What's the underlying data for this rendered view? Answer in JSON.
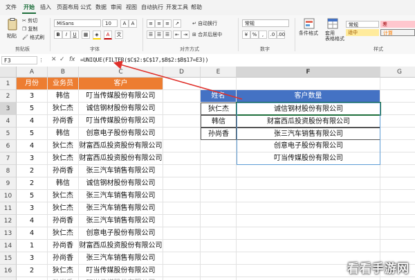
{
  "menu": [
    "文件",
    "开始",
    "插入",
    "页面布局",
    "公式",
    "数据",
    "审阅",
    "视图",
    "自动执行",
    "开发工具",
    "帮助"
  ],
  "menu_active_index": 1,
  "ribbon": {
    "paste": "粘贴",
    "cut": "剪切",
    "copy": "复制",
    "format_painter": "格式刷",
    "font_name": "MiSans",
    "font_size": "10",
    "wrap_text": "自动换行",
    "merge_center": "合并后居中",
    "number_format": "常规",
    "conditional_format": "条件格式",
    "format_as_table": "套用\n表格格式",
    "style_normal": "常规",
    "style_bad": "差",
    "style_neutral": "适中",
    "style_calc": "计算",
    "groups": {
      "clipboard": "剪贴板",
      "font": "字体",
      "alignment": "对齐方式",
      "number": "数字",
      "styles": "样式"
    },
    "colors": {
      "bad_bg": "#ffc7ce",
      "neutral_bg": "#ffeb9c",
      "calc_bg": "#f2f2f2"
    }
  },
  "formula_bar": {
    "namebox": "F3",
    "fx": "fx",
    "formula": "=UNIQUE(FILTER($C$2:$C$17,$B$2:$B$17=E3))"
  },
  "columns": [
    "A",
    "B",
    "C",
    "D",
    "E",
    "F",
    "G"
  ],
  "rows": [
    "1",
    "2",
    "3",
    "4",
    "5",
    "6",
    "7",
    "8",
    "9",
    "10",
    "11",
    "12",
    "13",
    "14",
    "15",
    "16",
    "17"
  ],
  "left_table": {
    "headers": [
      "月份",
      "业务员",
      "客户"
    ],
    "rows": [
      [
        "3",
        "韩信",
        "叮当传媒股份有限公司"
      ],
      [
        "5",
        "狄仁杰",
        "诚信钢材股份有限公司"
      ],
      [
        "4",
        "孙尚香",
        "叮当传媒股份有限公司"
      ],
      [
        "5",
        "韩信",
        "创意电子股份有限公司"
      ],
      [
        "4",
        "狄仁杰",
        "财富西瓜投资股份有限公司"
      ],
      [
        "3",
        "狄仁杰",
        "财富西瓜投资股份有限公司"
      ],
      [
        "2",
        "孙尚香",
        "张三汽车销售有限公司"
      ],
      [
        "2",
        "韩信",
        "诚信钢材股份有限公司"
      ],
      [
        "5",
        "狄仁杰",
        "张三汽车销售有限公司"
      ],
      [
        "3",
        "狄仁杰",
        "张三汽车销售有限公司"
      ],
      [
        "4",
        "孙尚香",
        "张三汽车销售有限公司"
      ],
      [
        "4",
        "狄仁杰",
        "创意电子股份有限公司"
      ],
      [
        "1",
        "孙尚香",
        "财富西瓜投资股份有限公司"
      ],
      [
        "3",
        "孙尚香",
        "张三汽车销售有限公司"
      ],
      [
        "2",
        "狄仁杰",
        "叮当传媒股份有限公司"
      ],
      [
        "2",
        "孙尚香",
        "叮当传媒股份有限公司"
      ]
    ]
  },
  "right_table": {
    "headers": [
      "姓名",
      "客户数量"
    ],
    "names": [
      "狄仁杰",
      "韩信",
      "孙尚香"
    ],
    "spill": [
      "诚信钢材股份有限公司",
      "财富西瓜投资股份有限公司",
      "张三汽车销售有限公司",
      "创意电子股份有限公司",
      "叮当传媒股份有限公司"
    ]
  },
  "watermark": "看看手游网",
  "colors": {
    "orange": "#ed7d31",
    "blue": "#4472c4",
    "arrow": "#e0302a",
    "green": "#1e6f3c"
  }
}
